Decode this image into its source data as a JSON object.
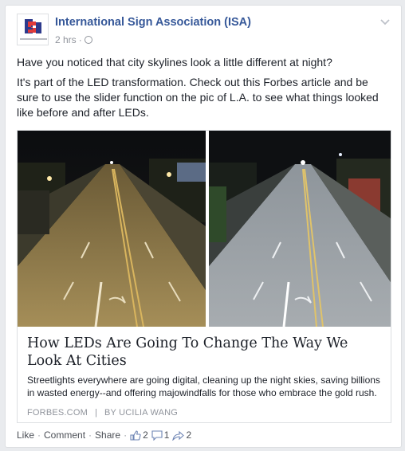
{
  "post": {
    "page_name": "International Sign Association (ISA)",
    "time": "2 hrs",
    "meta_sep": "·",
    "text_paragraphs": [
      "Have you noticed that city skylines look a little different at night?",
      "It's part of the LED transformation. Check out this Forbes article and be sure to use the slider function on the pic of L.A. to see what things looked like before and after LEDs."
    ]
  },
  "link": {
    "title": "How LEDs Are Going To Change The Way We Look At Cities",
    "description": "Streetlights everywhere are going digital, cleaning up the night skies, saving billions in wasted energy--and offering majowindfalls for those who embrace the gold rush.",
    "source": "FORBES.COM",
    "separator": "|",
    "author": "BY UCILIA WANG"
  },
  "actions": {
    "like": "Like",
    "comment": "Comment",
    "share": "Share",
    "dot": "·",
    "likes_count": "2",
    "comments_count": "1",
    "shares_count": "2"
  },
  "colors": {
    "link_blue": "#365899",
    "muted": "#90949c",
    "night_warm": "#c8a15a",
    "night_cool": "#c9d0d6"
  },
  "icons": [
    "globe-icon",
    "chevron-down-icon",
    "thumbs-up-icon",
    "comment-icon",
    "share-icon"
  ]
}
